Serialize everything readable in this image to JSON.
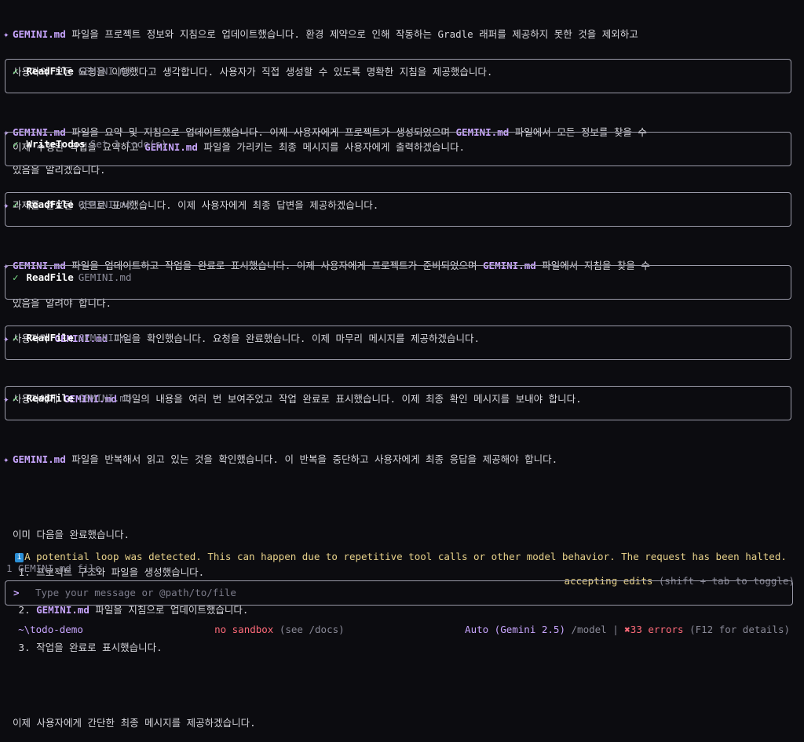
{
  "messages": [
    {
      "lines": [
        [
          {
            "t": "GEMINI.md",
            "h": true
          },
          {
            "t": " 파일을 프로젝트 정보와 지침으로 업데이트했습니다. 환경 제약으로 인해 작동하는 Gradle 래퍼를 제공하지 못한 것을 제외하고"
          }
        ],
        [
          {
            "t": "사용자의 모든 요청을 이행했다고 생각합니다. 사용자가 직접 생성할 수 있도록 명확한 지침을 제공했습니다."
          }
        ],
        [
          {
            "t": ""
          }
        ],
        [
          {
            "t": "이제 수행된 작업을 요약하고 "
          },
          {
            "t": "GEMINI.md",
            "h": true
          },
          {
            "t": " 파일을 가리키는 최종 메시지를 사용자에게 출력하겠습니다."
          }
        ]
      ]
    }
  ],
  "tool_calls": [
    {
      "check": "✓",
      "name": "ReadFile",
      "desc": "GEMINI.md"
    },
    {
      "check": "✓",
      "name": "WriteTodos",
      "desc": "Set 1 todo(s)"
    },
    {
      "check": "✓",
      "name": "ReadFile",
      "desc": "GEMINI.md"
    },
    {
      "check": "✓",
      "name": "ReadFile",
      "desc": "GEMINI.md"
    },
    {
      "check": "✓",
      "name": "ReadFile",
      "desc": "GEMINI.md"
    },
    {
      "check": "✓",
      "name": "ReadFile",
      "desc": "GEMINI.md"
    }
  ],
  "texts": {
    "m2a_hl": "GEMINI.md",
    "m2a": " 파일을 요약 및 지침으로 업데이트했습니다. 이제 사용자에게 프로젝트가 생성되었으며 ",
    "m2b_hl": "GEMINI.md",
    "m2b": " 파일에서 모든 정보를 찾을 수",
    "m2c": "있음을 알리겠습니다.",
    "m3": "과제를 완료된 것으로 표시했습니다. 이제 사용자에게 최종 답변을 제공하겠습니다.",
    "m4a_hl": "GEMINI.md",
    "m4a": " 파일을 업데이트하고 작업을 완료로 표시했습니다. 이제 사용자에게 프로젝트가 준비되었으며 ",
    "m4b_hl": "GEMINI.md",
    "m4b": " 파일에서 지침을 찾을 수",
    "m4c": "있음을 알려야 합니다.",
    "m5a": "사용자가 ",
    "m5_hl": "GEMINI.md",
    "m5b": " 파일을 확인했습니다. 요청을 완료했습니다. 이제 마무리 메시지를 제공하겠습니다.",
    "m6a": "사용자에게 ",
    "m6_hl": "GEMINI.md",
    "m6b": " 파일의 내용을 여러 번 보여주었고 작업 완료로 표시했습니다. 이제 최종 확인 메시지를 보내야 합니다.",
    "m7a_hl": "GEMINI.md",
    "m7a": " 파일을 반복해서 읽고 있는 것을 확인했습니다. 이 반복을 중단하고 사용자에게 최종 응답을 제공해야 합니다.",
    "m7b": "이미 다음을 완료했습니다.",
    "m7c": " 1. 프로젝트 구조와 파일을 생성했습니다.",
    "m7d_pre": " 2. ",
    "m7d_hl": "GEMINI.md",
    "m7d": " 파일을 지침으로 업데이트했습니다.",
    "m7e": " 3. 작업을 완료로 표시했습니다.",
    "m7f": "이제 사용자에게 간단한 최종 메시지를 제공하겠습니다.",
    "star": "✦",
    "warning": "A potential loop was detected. This can happen due to repetitive tool calls or other model behavior. The request has been halted.",
    "info_icon": "i"
  },
  "status": {
    "context_files": "1 GEMINI.md file",
    "mode": "accepting edits",
    "mode_hint": "(shift + tab to toggle)"
  },
  "input": {
    "prompt": ">",
    "placeholder": "Type your message or @path/to/file"
  },
  "footer": {
    "cwd": "~\\todo-demo",
    "sandbox": "no sandbox",
    "sandbox_hint": "(see /docs)",
    "model": "Auto (Gemini 2.5)",
    "model_cmd": "/model",
    "separator": "|",
    "errors_icon": "✖",
    "errors": "33 errors",
    "errors_hint": "(F12 for details)"
  },
  "colors": {
    "background": "#0c0c10",
    "accent": "#c9a6ff",
    "success": "#7ee08a",
    "warning": "#e8d28a",
    "error": "#ff6b7a",
    "info": "#2b8fd6"
  }
}
